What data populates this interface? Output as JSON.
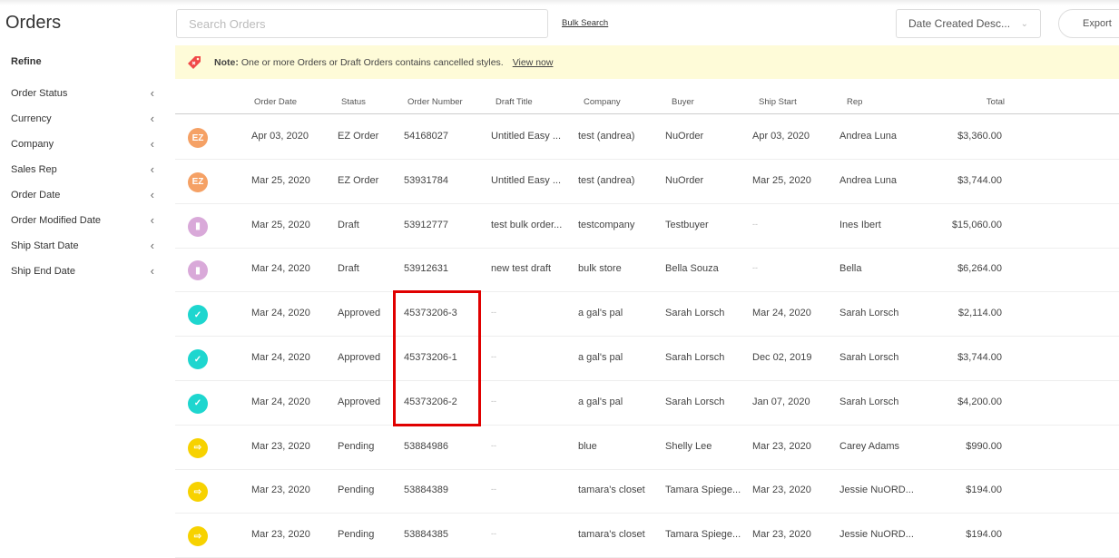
{
  "page": {
    "title": "Orders"
  },
  "sidebar": {
    "refine_label": "Refine",
    "filters": [
      "Order Status",
      "Currency",
      "Company",
      "Sales Rep",
      "Order Date",
      "Order Modified Date",
      "Ship Start Date",
      "Ship End Date"
    ]
  },
  "toolbar": {
    "search_placeholder": "Search Orders",
    "search_value": "",
    "bulk_search": "Bulk Search",
    "sort_selected": "Date Created Desc...",
    "export": "Export"
  },
  "note": {
    "label": "Note:",
    "text": "One or more Orders or Draft Orders contains cancelled styles.",
    "link": "View now"
  },
  "table": {
    "headers": [
      "Order Date",
      "Status",
      "Order Number",
      "Draft Title",
      "Company",
      "Buyer",
      "Ship Start",
      "Rep",
      "Total"
    ],
    "status_colors": {
      "EZ Order": "#f5a165",
      "Draft": "#d9a9d9",
      "Approved": "#1ed6cf",
      "Pending": "#f7d200"
    },
    "rows": [
      {
        "icon": "ez-order-icon",
        "icon_text": "EZ",
        "order_date": "Apr 03, 2020",
        "status": "EZ Order",
        "order_number": "54168027",
        "draft_title": "Untitled Easy ...",
        "company": "test (andrea)",
        "buyer": "NuOrder",
        "ship_start": "Apr 03, 2020",
        "rep": "Andrea Luna",
        "total": "$3,360.00"
      },
      {
        "icon": "ez-order-icon",
        "icon_text": "EZ",
        "order_date": "Mar 25, 2020",
        "status": "EZ Order",
        "order_number": "53931784",
        "draft_title": "Untitled Easy ...",
        "company": "test (andrea)",
        "buyer": "NuOrder",
        "ship_start": "Mar 25, 2020",
        "rep": "Andrea Luna",
        "total": "$3,744.00"
      },
      {
        "icon": "draft-document-icon",
        "icon_text": "",
        "order_date": "Mar 25, 2020",
        "status": "Draft",
        "order_number": "53912777",
        "draft_title": "test bulk order...",
        "company": "testcompany",
        "buyer": "Testbuyer",
        "ship_start": "--",
        "rep": "Ines Ibert",
        "total": "$15,060.00"
      },
      {
        "icon": "draft-document-icon",
        "icon_text": "",
        "order_date": "Mar 24, 2020",
        "status": "Draft",
        "order_number": "53912631",
        "draft_title": "new test draft",
        "company": "bulk store",
        "buyer": "Bella Souza",
        "ship_start": "--",
        "rep": "Bella",
        "total": "$6,264.00"
      },
      {
        "icon": "approved-check-icon",
        "icon_text": "",
        "order_date": "Mar 24, 2020",
        "status": "Approved",
        "order_number": "45373206-3",
        "draft_title": "--",
        "company": "a gal's pal",
        "buyer": "Sarah Lorsch",
        "ship_start": "Mar 24, 2020",
        "rep": "Sarah Lorsch",
        "total": "$2,114.00"
      },
      {
        "icon": "approved-check-icon",
        "icon_text": "",
        "order_date": "Mar 24, 2020",
        "status": "Approved",
        "order_number": "45373206-1",
        "draft_title": "--",
        "company": "a gal's pal",
        "buyer": "Sarah Lorsch",
        "ship_start": "Dec 02, 2019",
        "rep": "Sarah Lorsch",
        "total": "$3,744.00"
      },
      {
        "icon": "approved-check-icon",
        "icon_text": "",
        "order_date": "Mar 24, 2020",
        "status": "Approved",
        "order_number": "45373206-2",
        "draft_title": "--",
        "company": "a gal's pal",
        "buyer": "Sarah Lorsch",
        "ship_start": "Jan 07, 2020",
        "rep": "Sarah Lorsch",
        "total": "$4,200.00"
      },
      {
        "icon": "pending-import-icon",
        "icon_text": "",
        "order_date": "Mar 23, 2020",
        "status": "Pending",
        "order_number": "53884986",
        "draft_title": "--",
        "company": "blue",
        "buyer": "Shelly Lee",
        "ship_start": "Mar 23, 2020",
        "rep": "Carey Adams",
        "total": "$990.00"
      },
      {
        "icon": "pending-import-icon",
        "icon_text": "",
        "order_date": "Mar 23, 2020",
        "status": "Pending",
        "order_number": "53884389",
        "draft_title": "--",
        "company": "tamara's closet",
        "buyer": "Tamara Spiege...",
        "ship_start": "Mar 23, 2020",
        "rep": "Jessie NuORD...",
        "total": "$194.00"
      },
      {
        "icon": "pending-import-icon",
        "icon_text": "",
        "order_date": "Mar 23, 2020",
        "status": "Pending",
        "order_number": "53884385",
        "draft_title": "--",
        "company": "tamara's closet",
        "buyer": "Tamara Spiege...",
        "ship_start": "Mar 23, 2020",
        "rep": "Jessie NuORD...",
        "total": "$194.00"
      }
    ]
  }
}
